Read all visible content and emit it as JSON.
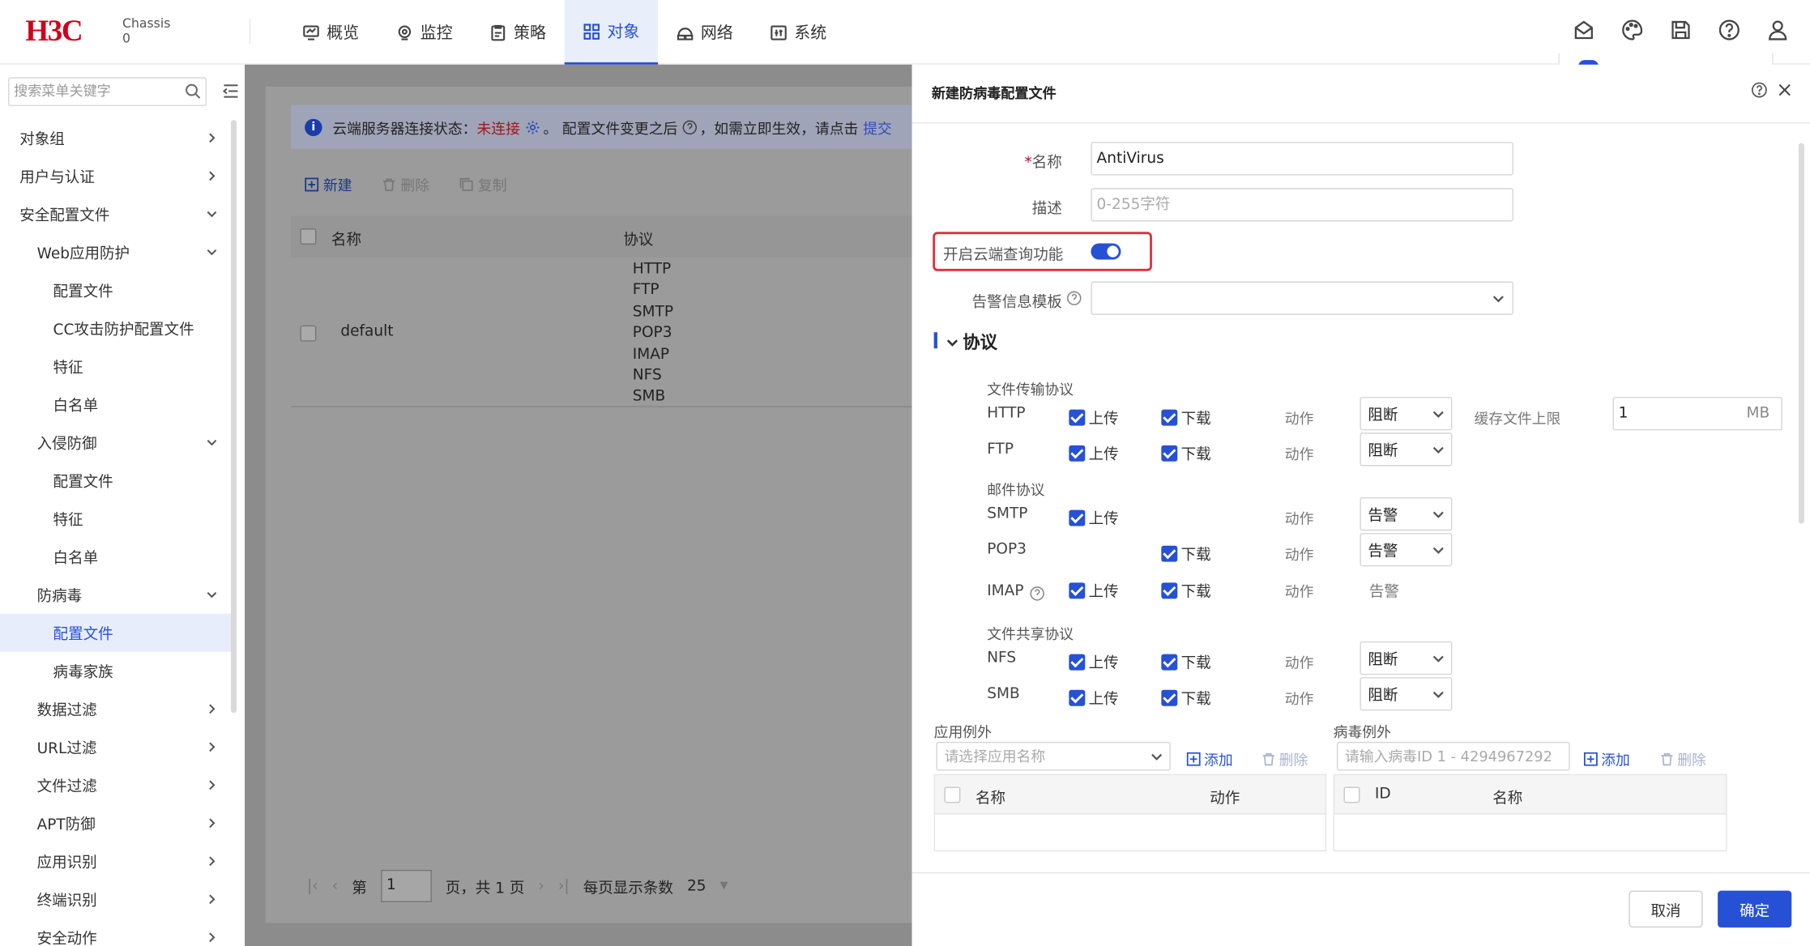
{
  "header": {
    "logo": "H3C",
    "chassis_line1": "Chassis",
    "chassis_line2": "0",
    "nav": [
      {
        "label": "概览",
        "icon": "dashboard-icon"
      },
      {
        "label": "监控",
        "icon": "monitor-icon"
      },
      {
        "label": "策略",
        "icon": "policy-icon"
      },
      {
        "label": "对象",
        "icon": "object-icon",
        "active": true
      },
      {
        "label": "网络",
        "icon": "network-icon"
      },
      {
        "label": "系统",
        "icon": "system-icon"
      }
    ]
  },
  "sidebar": {
    "search_placeholder": "搜索菜单关键字",
    "items": [
      {
        "label": "对象组"
      },
      {
        "label": "用户与认证"
      },
      {
        "label": "安全配置文件"
      },
      {
        "label": "Web应用防护"
      },
      {
        "label": "配置文件"
      },
      {
        "label": "CC攻击防护配置文件"
      },
      {
        "label": "特征"
      },
      {
        "label": "白名单"
      },
      {
        "label": "入侵防御"
      },
      {
        "label": "配置文件"
      },
      {
        "label": "特征"
      },
      {
        "label": "白名单"
      },
      {
        "label": "防病毒"
      },
      {
        "label": "配置文件"
      },
      {
        "label": "病毒家族"
      },
      {
        "label": "数据过滤"
      },
      {
        "label": "URL过滤"
      },
      {
        "label": "文件过滤"
      },
      {
        "label": "APT防御"
      },
      {
        "label": "应用识别"
      },
      {
        "label": "终端识别"
      },
      {
        "label": "安全动作"
      }
    ]
  },
  "main": {
    "notice_prefix": "云端服务器连接状态：",
    "notice_status": "未连接",
    "notice_mid": "。 配置文件变更之后",
    "notice_suffix": "，如需立即生效，请点击",
    "notice_link": "提交",
    "toolbar": {
      "new": "新建",
      "delete": "删除",
      "copy": "复制"
    },
    "columns": {
      "name": "名称",
      "protocol": "协议"
    },
    "row": {
      "name": "default",
      "protocols": [
        "HTTP",
        "FTP",
        "SMTP",
        "POP3",
        "IMAP",
        "NFS",
        "SMB"
      ]
    },
    "pager": {
      "page_prefix": "第",
      "page_value": "1",
      "page_suffix": "页，共 1 页",
      "per_page_label": "每页显示条数",
      "per_page_value": "25"
    }
  },
  "drawer": {
    "title": "新建防病毒配置文件",
    "name_label": "名称",
    "name_required_mark": "*",
    "name_value": "AntiVirus",
    "desc_label": "描述",
    "desc_placeholder": "0-255字符",
    "cloud_label": "开启云端查询功能",
    "cloud_enabled": true,
    "alarm_label": "告警信息模板",
    "section_protocol": "协议",
    "group_file_transfer": "文件传输协议",
    "group_mail": "邮件协议",
    "group_file_share": "文件共享协议",
    "upload_label": "上传",
    "download_label": "下载",
    "action_label": "动作",
    "cache_label": "缓存文件上限",
    "cache_value": "1",
    "cache_unit": "MB",
    "protocols": {
      "http": {
        "name": "HTTP",
        "action": "阻断"
      },
      "ftp": {
        "name": "FTP",
        "action": "阻断"
      },
      "smtp": {
        "name": "SMTP",
        "action": "告警"
      },
      "pop3": {
        "name": "POP3",
        "action": "告警"
      },
      "imap": {
        "name": "IMAP",
        "action": "告警"
      },
      "nfs": {
        "name": "NFS",
        "action": "阻断"
      },
      "smb": {
        "name": "SMB",
        "action": "阻断"
      }
    },
    "app_exception": {
      "title": "应用例外",
      "placeholder": "请选择应用名称",
      "add": "添加",
      "delete": "删除",
      "col_name": "名称",
      "col_action": "动作"
    },
    "virus_exception": {
      "title": "病毒例外",
      "placeholder": "请输入病毒ID 1 - 4294967292",
      "add": "添加",
      "delete": "删除",
      "col_id": "ID",
      "col_name": "名称"
    },
    "cancel": "取消",
    "ok": "确定"
  },
  "colors": {
    "accent": "#2651d6",
    "brand": "#d0021b",
    "highlight": "#e0303f"
  }
}
